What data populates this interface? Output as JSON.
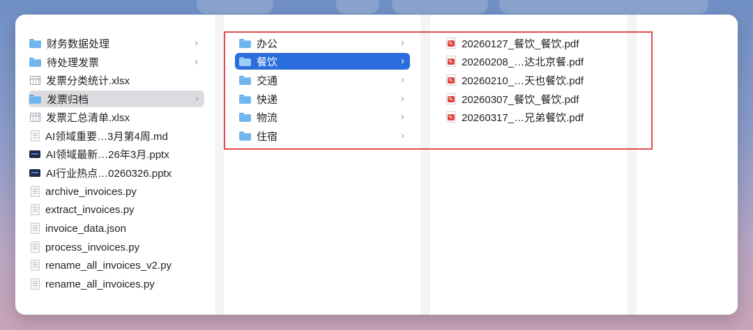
{
  "sidebar": {
    "items": [
      {
        "label": "财务数据处理",
        "icon": "folder-icon",
        "type": "folder"
      },
      {
        "label": "待处理发票",
        "icon": "folder-icon",
        "type": "folder"
      },
      {
        "label": "发票分类统计.xlsx",
        "icon": "spreadsheet-icon",
        "type": "file"
      },
      {
        "label": "发票归档",
        "icon": "folder-icon",
        "type": "folder",
        "selected": true
      },
      {
        "label": "发票汇总清单.xlsx",
        "icon": "spreadsheet-icon",
        "type": "file"
      },
      {
        "label": "AI领域重要…3月第4周.md",
        "icon": "document-icon",
        "type": "file"
      },
      {
        "label": "AI领域最新…26年3月.pptx",
        "icon": "presentation-icon",
        "type": "file"
      },
      {
        "label": "AI行业热点…0260326.pptx",
        "icon": "presentation-icon",
        "type": "file"
      },
      {
        "label": "archive_invoices.py",
        "icon": "document-icon",
        "type": "file"
      },
      {
        "label": "extract_invoices.py",
        "icon": "document-icon",
        "type": "file"
      },
      {
        "label": "invoice_data.json",
        "icon": "document-icon",
        "type": "file"
      },
      {
        "label": "process_invoices.py",
        "icon": "document-icon",
        "type": "file"
      },
      {
        "label": "rename_all_invoices_v2.py",
        "icon": "document-icon",
        "type": "file"
      },
      {
        "label": "rename_all_invoices.py",
        "icon": "document-icon",
        "type": "file"
      }
    ]
  },
  "column2": {
    "items": [
      {
        "label": "办公",
        "icon": "folder-icon"
      },
      {
        "label": "餐饮",
        "icon": "folder-icon",
        "selected": true
      },
      {
        "label": "交通",
        "icon": "folder-icon"
      },
      {
        "label": "快递",
        "icon": "folder-icon"
      },
      {
        "label": "物流",
        "icon": "folder-icon"
      },
      {
        "label": "住宿",
        "icon": "folder-icon"
      }
    ]
  },
  "column3": {
    "items": [
      {
        "label": "20260127_餐饮_餐饮.pdf",
        "icon": "pdf-icon"
      },
      {
        "label": "20260208_…达北京餐.pdf",
        "icon": "pdf-icon"
      },
      {
        "label": "20260210_…天也餐饮.pdf",
        "icon": "pdf-icon"
      },
      {
        "label": "20260307_餐饮_餐饮.pdf",
        "icon": "pdf-icon"
      },
      {
        "label": "20260317_…兄弟餐饮.pdf",
        "icon": "pdf-icon"
      }
    ]
  },
  "colors": {
    "selection_blue": "#2b6dde",
    "selection_grey": "#dcdce0",
    "highlight_red": "#e5484d",
    "folder_blue": "#6fb6ef",
    "pdf_red": "#e0413a"
  },
  "chevron": "›"
}
